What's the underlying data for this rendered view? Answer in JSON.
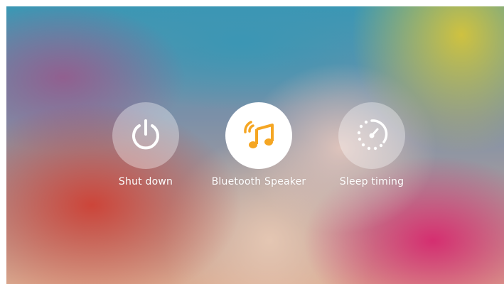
{
  "menu": {
    "items": [
      {
        "label": "Shut down",
        "icon": "power-icon",
        "active": false
      },
      {
        "label": "Bluetooth Speaker",
        "icon": "music-note-icon",
        "active": true
      },
      {
        "label": "Sleep timing",
        "icon": "timer-icon",
        "active": false
      }
    ]
  },
  "colors": {
    "accent": "#f5a623",
    "icon_light": "#ffffff",
    "active_circle": "#ffffff"
  }
}
